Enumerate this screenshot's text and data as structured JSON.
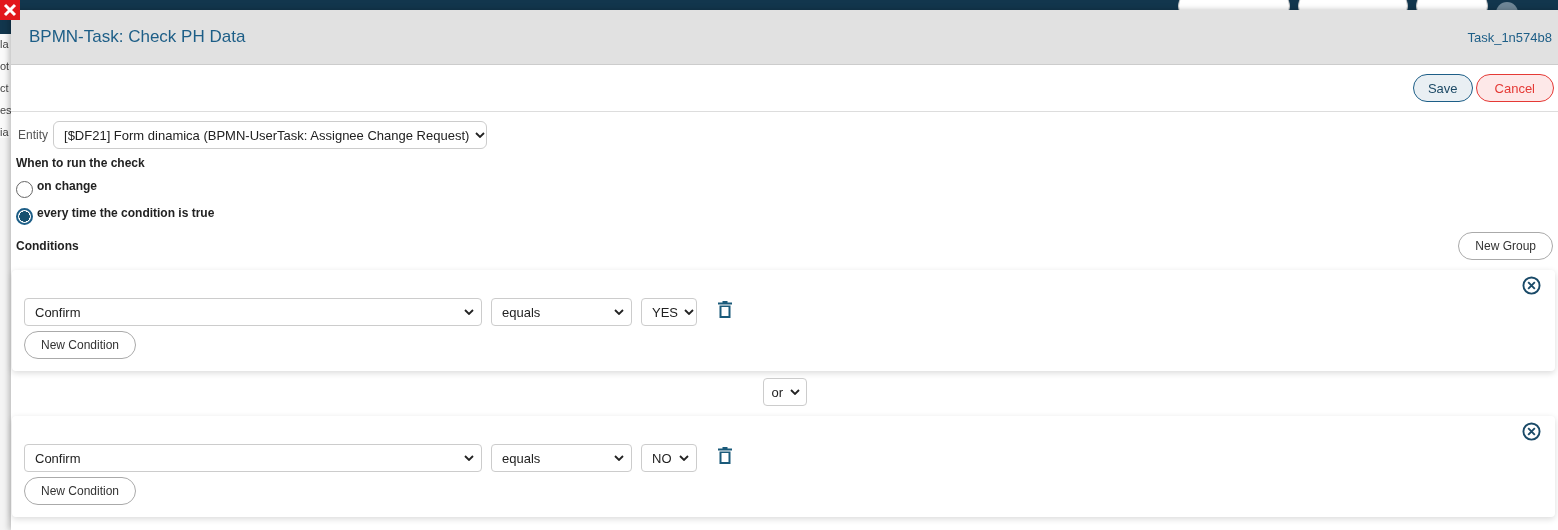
{
  "background": {
    "sidebar_fragments": [
      "la",
      "ot",
      "ct",
      "es",
      "ia"
    ]
  },
  "dialog": {
    "title": "BPMN-Task: Check PH Data",
    "task_id": "Task_1n574b8",
    "buttons": [
      {
        "label": "Save",
        "kind": "primary"
      },
      {
        "label": "Cancel",
        "kind": "danger"
      }
    ]
  },
  "entity": {
    "label": "Entity",
    "value": "[$DF21] Form dinamica (BPMN-UserTask: Assignee Change Request)"
  },
  "run_check": {
    "label": "When to run the check",
    "options": [
      {
        "label": "on change",
        "selected": false
      },
      {
        "label": "every time the condition is true",
        "selected": true
      }
    ]
  },
  "conditions": {
    "label": "Conditions",
    "new_group": "New Group",
    "joiners": [
      "or"
    ],
    "groups": [
      {
        "rows": [
          {
            "field": "Confirm",
            "operator": "equals",
            "value": "YES"
          }
        ],
        "new_condition": "New Condition"
      },
      {
        "rows": [
          {
            "field": "Confirm",
            "operator": "equals",
            "value": "NO"
          }
        ],
        "new_condition": "New Condition"
      }
    ]
  }
}
